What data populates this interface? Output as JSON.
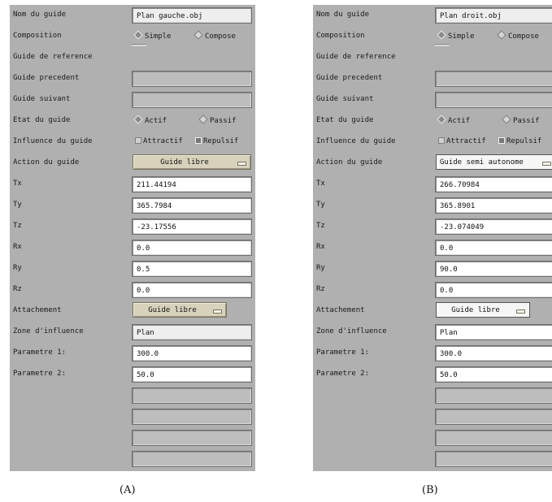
{
  "labels": {
    "nom": "Nom du guide",
    "composition": "Composition",
    "reference": "Guide de reference",
    "precedent": "Guide precedent",
    "suivant": "Guide suivant",
    "etat": "Etat du guide",
    "influence": "Influence du guide",
    "action": "Action du guide",
    "tx": "Tx",
    "ty": "Ty",
    "tz": "Tz",
    "rx": "Rx",
    "ry": "Ry",
    "rz": "Rz",
    "attachement": "Attachement",
    "zone": "Zone d'influence",
    "param1": "Parametre 1:",
    "param2": "Parametre 2:"
  },
  "options": {
    "simple": "Simple",
    "compose": "Compose",
    "actif": "Actif",
    "passif": "Passif",
    "attractif": "Attractif",
    "repulsif": "Repulsif"
  },
  "panel_a": {
    "caption": "(A)",
    "nom": "Plan gauche.obj",
    "action": "Guide libre",
    "tx": "211.44194",
    "ty": "365.7984",
    "tz": "-23.17556",
    "rx": "0.0",
    "ry": "0.5",
    "rz": "0.0",
    "attachement": "Guide libre",
    "zone": "Plan",
    "param1": "300.0",
    "param2": "50.0"
  },
  "panel_b": {
    "caption": "(B)",
    "nom": "Plan droit.obj",
    "action": "Guide semi autonome",
    "tx": "266.70984",
    "ty": "365.8901",
    "tz": "-23.074049",
    "rx": "0.0",
    "ry": "90.0",
    "rz": "0.0",
    "attachement": "Guide libre",
    "zone": "Plan",
    "param1": "300.0",
    "param2": "50.0"
  }
}
